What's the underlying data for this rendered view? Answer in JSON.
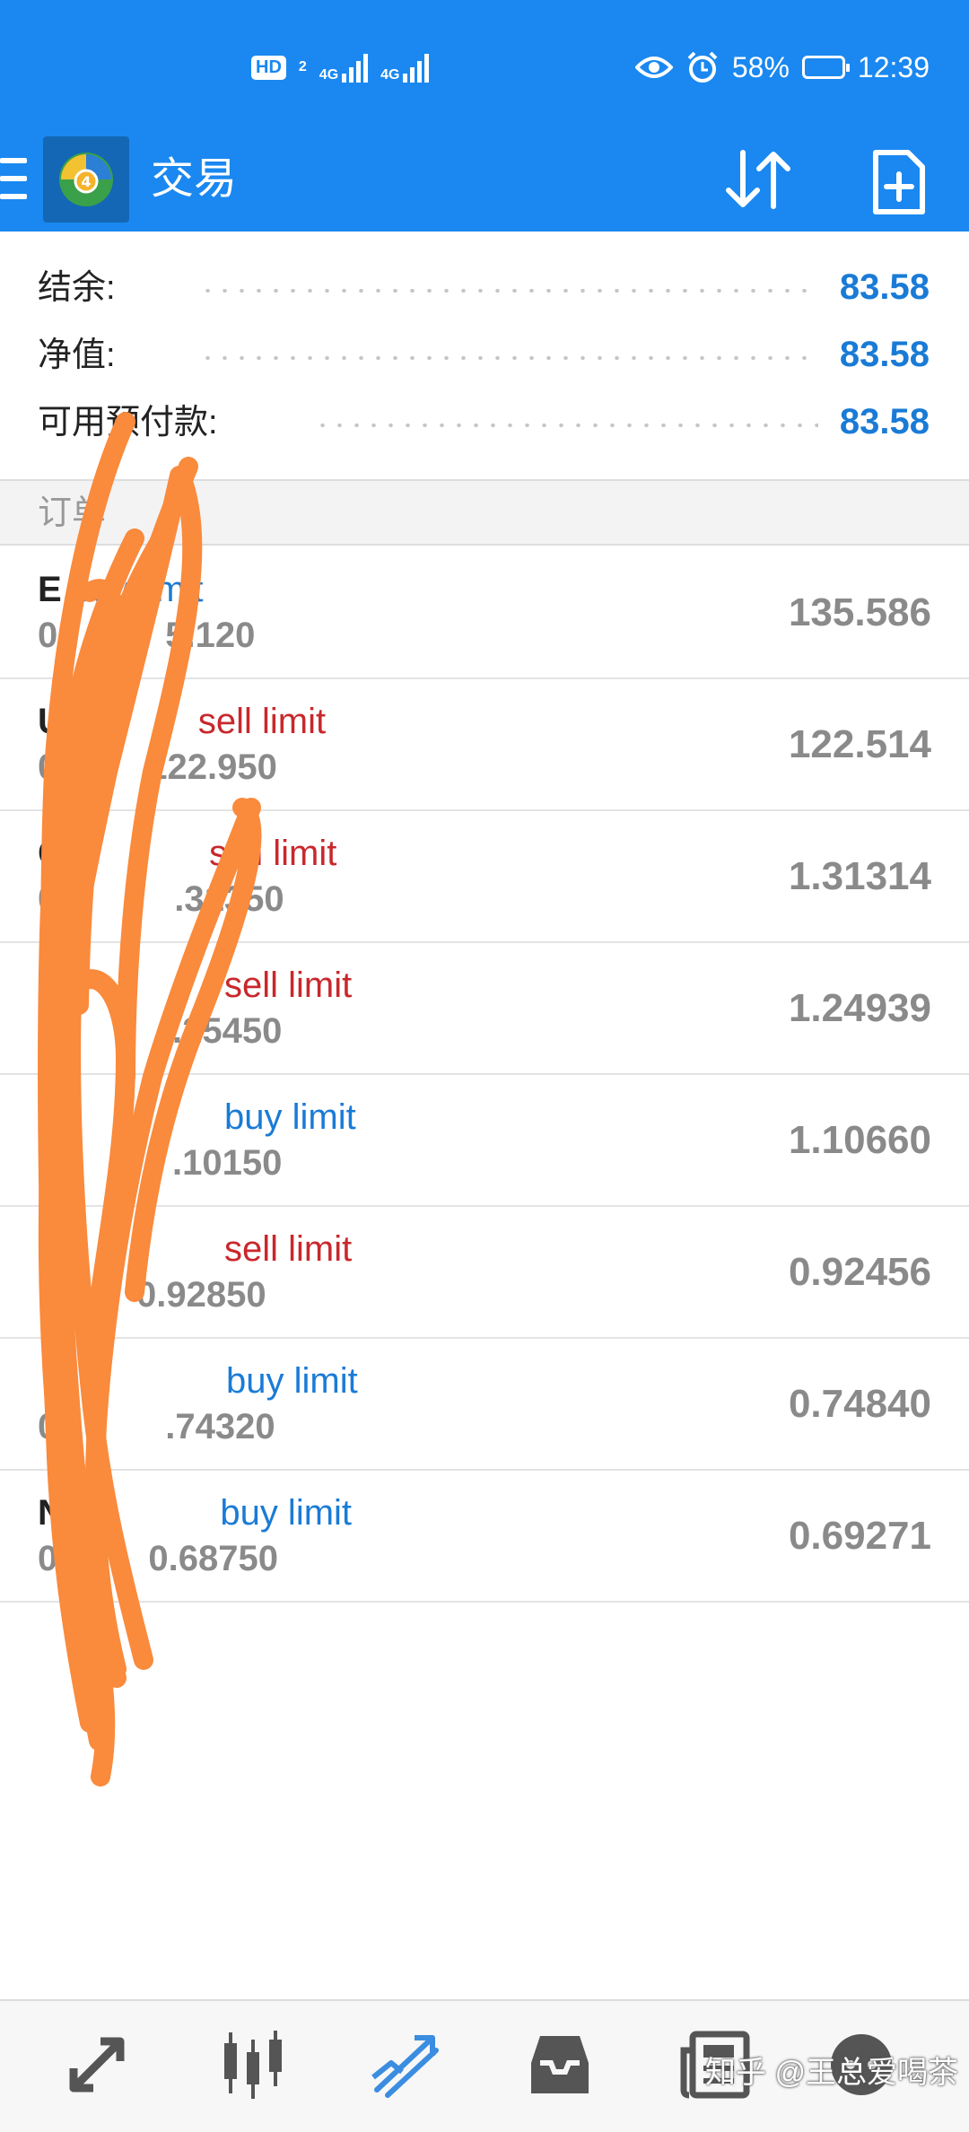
{
  "status_bar": {
    "hd_badge": "HD",
    "sim1": "4G",
    "sim2": "4G",
    "battery": "58%",
    "time": "12:39"
  },
  "app_bar": {
    "title": "交易",
    "icons": [
      "menu-icon",
      "metatrader-logo",
      "sort-icon",
      "new-order-icon"
    ]
  },
  "summary": {
    "balance": {
      "label": "结余:",
      "value": "83.58"
    },
    "equity": {
      "label": "净值:",
      "value": "83.58"
    },
    "free_margin": {
      "label": "可用预付款:",
      "value": "83.58"
    }
  },
  "orders_section": {
    "title": "订单"
  },
  "orders": [
    {
      "symbol": "E",
      "type": "buy limit",
      "type_color": "buy",
      "sub": "0",
      "sub_tail": "5.120",
      "price": "135.586"
    },
    {
      "symbol": "U",
      "type": "sell limit",
      "type_color": "sell",
      "sub": "0",
      "sub_tail": "122.950",
      "price": "122.514"
    },
    {
      "symbol": "G",
      "type": "sell limit",
      "type_color": "sell",
      "sub": "0",
      "sub_tail": ".31350",
      "price": "1.31314"
    },
    {
      "symbol": "",
      "type": "sell limit",
      "type_color": "sell",
      "sub": "",
      "sub_tail": ".25450",
      "price": "1.24939"
    },
    {
      "symbol": "",
      "type": "buy limit",
      "type_color": "buy",
      "sub": "",
      "sub_tail": ".10150",
      "price": "1.10660"
    },
    {
      "symbol": "",
      "type": "sell limit",
      "type_color": "sell",
      "sub": "",
      "sub_tail": "0.92850",
      "price": "0.92456"
    },
    {
      "symbol": "",
      "type": "buy limit",
      "type_color": "buy",
      "sub": "0",
      "sub_tail": ".74320",
      "price": "0.74840"
    },
    {
      "symbol": "NZ",
      "type": "buy limit",
      "type_color": "buy",
      "sub": "0.",
      "sub_tail": "0.68750",
      "price": "0.69271"
    }
  ],
  "bottom_nav": {
    "items": [
      "quotes-icon",
      "chart-icon",
      "trade-icon",
      "history-icon",
      "news-icon",
      "messages-icon"
    ],
    "active": "trade-icon"
  },
  "watermark": "知乎 @王总爱喝茶",
  "colors": {
    "primary": "#1a88f0",
    "buy": "#1a7bd6",
    "sell": "#c8282c",
    "scribble": "#fa8a3c"
  }
}
